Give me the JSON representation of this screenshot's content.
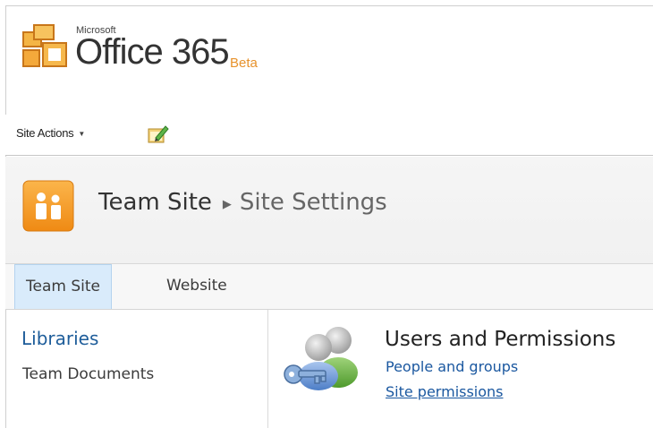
{
  "brand": {
    "microsoft": "Microsoft",
    "office": "Office 365",
    "beta": "Beta",
    "colors": {
      "orange": "#e7922c",
      "link_blue": "#1b58a0"
    }
  },
  "ribbon": {
    "site_actions": "Site Actions",
    "edit_icon": "edit-page-icon"
  },
  "title": {
    "site": "Team Site",
    "current": "Site Settings",
    "separator_icon": "breadcrumb-arrow-icon"
  },
  "topnav": {
    "tabs": [
      {
        "label": "Team Site",
        "active": true
      },
      {
        "label": "Website",
        "active": false
      }
    ]
  },
  "quicklaunch": {
    "heading": "Libraries",
    "items": [
      "Team Documents"
    ]
  },
  "section": {
    "title": "Users and Permissions",
    "icon": "users-key-icon",
    "links": [
      "People and groups",
      "Site permissions"
    ]
  }
}
